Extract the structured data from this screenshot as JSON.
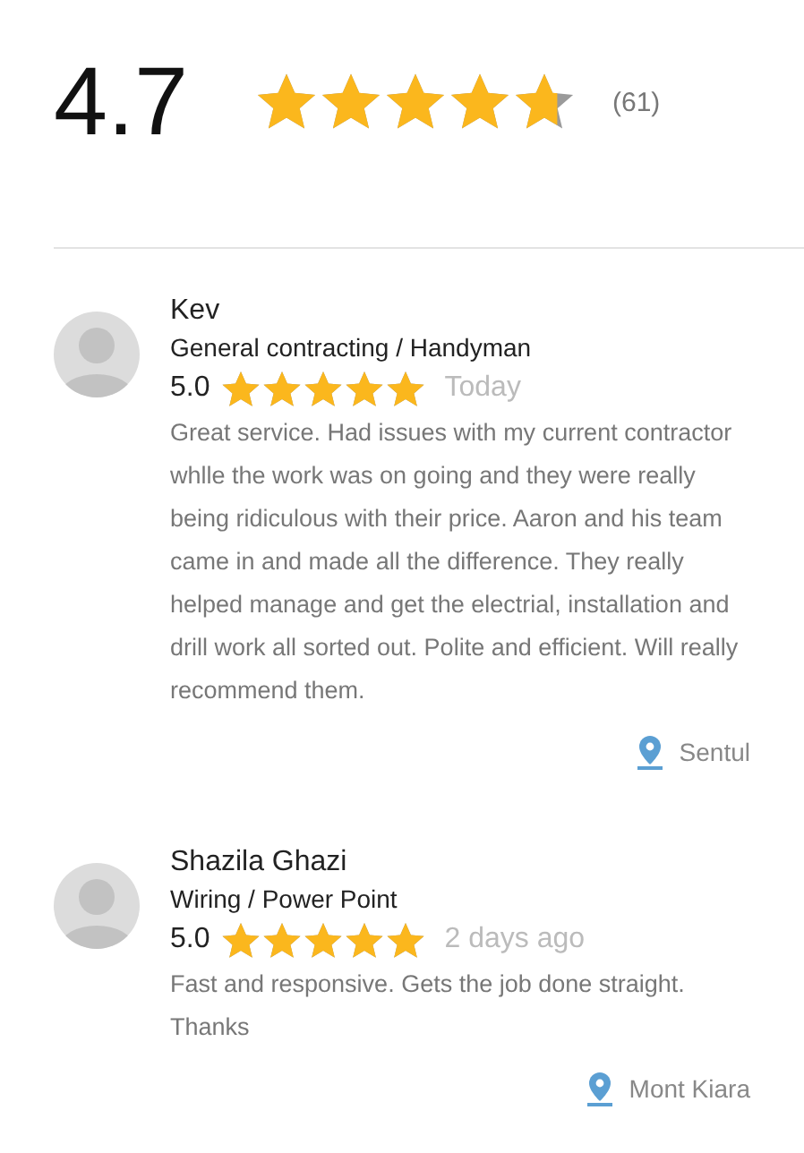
{
  "summary": {
    "score": "4.7",
    "stars": 4.7,
    "count": "(61)"
  },
  "reviews": [
    {
      "name": "Kev",
      "category": "General contracting / Handyman",
      "score": "5.0",
      "stars": 5,
      "date": "Today",
      "text": "Great service. Had issues with my current contractor whlle the work was on going and they were really being ridiculous with their price. Aaron and his team came in and made all the difference. They really helped manage and get the electrial, installation and drill work all sorted out. Polite and efficient. Will really recommend them.",
      "location": "Sentul"
    },
    {
      "name": "Shazila Ghazi",
      "category": "Wiring / Power Point",
      "score": "5.0",
      "stars": 5,
      "date": "2 days ago",
      "text": "Fast and responsive. Gets the job done straight. Thanks",
      "location": "Mont Kiara"
    }
  ]
}
